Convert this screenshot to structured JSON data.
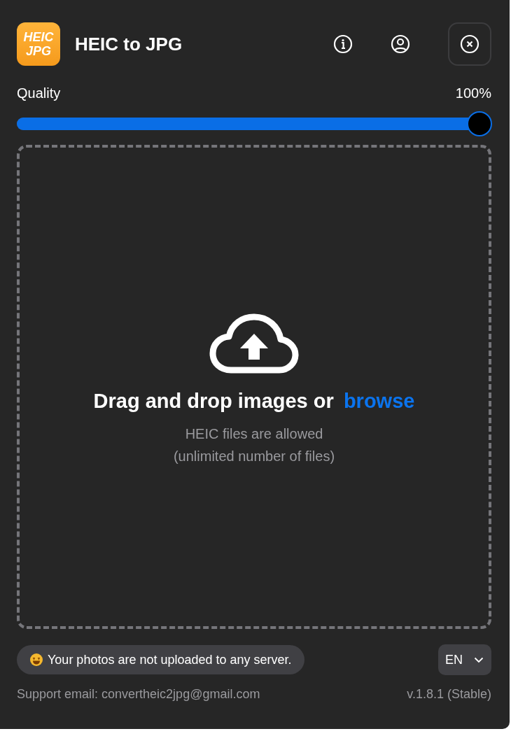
{
  "header": {
    "logo": [
      "HEIC",
      "JPG"
    ],
    "title": "HEIC to JPG"
  },
  "quality": {
    "label": "Quality",
    "reading": "100%",
    "level": 1.0
  },
  "dropzone": {
    "text": "Drag and drop images or",
    "link": "browse",
    "hints": [
      "HEIC files are allowed",
      "(unlimited number of files)"
    ]
  },
  "notice": "Your photos are not uploaded to any server.",
  "language": {
    "value": "EN"
  },
  "support": "Support email: convertheic2jpg@gmail.com",
  "version": "v.1.8.1 (Stable)"
}
